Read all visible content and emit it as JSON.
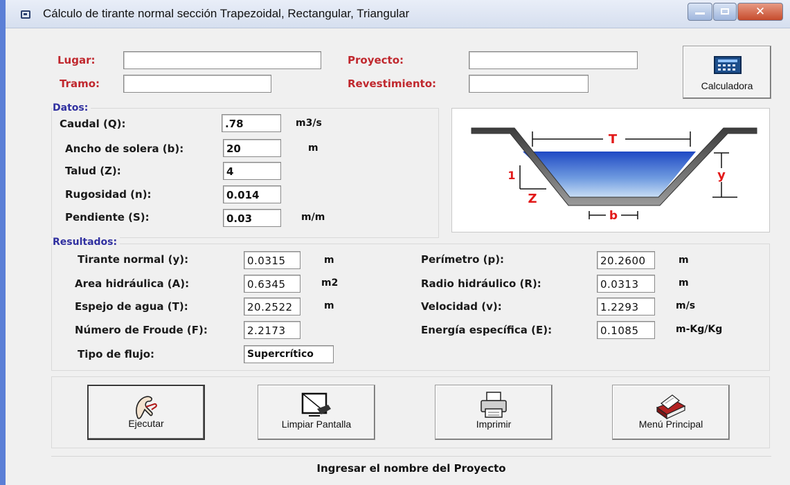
{
  "window": {
    "title": "Cálculo de tirante normal sección Trapezoidal, Rectangular, Triangular"
  },
  "header": {
    "lugar_label": "Lugar:",
    "lugar_value": "",
    "proyecto_label": "Proyecto:",
    "proyecto_value": "",
    "tramo_label": "Tramo:",
    "tramo_value": "",
    "revestimiento_label": "Revestimiento:",
    "revestimiento_value": "",
    "calc_button_label": "Calculadora"
  },
  "datos": {
    "section_label": "Datos:",
    "caudal_label": "Caudal (Q):",
    "caudal_value": ".78",
    "caudal_unit": "m3/s",
    "ancho_label": "Ancho de solera (b):",
    "ancho_value": "20",
    "ancho_unit": "m",
    "talud_label": "Talud (Z):",
    "talud_value": "4",
    "rugosidad_label": "Rugosidad (n):",
    "rugosidad_value": "0.014",
    "pendiente_label": "Pendiente (S):",
    "pendiente_value": "0.03",
    "pendiente_unit": "m/m"
  },
  "diagram": {
    "T": "T",
    "one": "1",
    "Z": "Z",
    "y": "y",
    "b": "b"
  },
  "resultados": {
    "section_label": "Resultados:",
    "tirante_label": "Tirante normal (y):",
    "tirante_value": "0.0315",
    "tirante_unit": "m",
    "area_label": "Area hidráulica (A):",
    "area_value": "0.6345",
    "area_unit": "m2",
    "espejo_label": "Espejo de agua (T):",
    "espejo_value": "20.2522",
    "espejo_unit": "m",
    "froude_label": "Número de Froude (F):",
    "froude_value": "2.2173",
    "tipo_label": "Tipo de flujo:",
    "tipo_value": "Supercrítico",
    "perimetro_label": "Perímetro (p):",
    "perimetro_value": "20.2600",
    "perimetro_unit": "m",
    "radio_label": "Radio hidráulico (R):",
    "radio_value": "0.0313",
    "radio_unit": "m",
    "velocidad_label": "Velocidad (v):",
    "velocidad_value": "1.2293",
    "velocidad_unit": "m/s",
    "energia_label": "Energía específica (E):",
    "energia_value": "0.1085",
    "energia_unit": "m-Kg/Kg"
  },
  "buttons": {
    "ejecutar": "Ejecutar",
    "limpiar": "Limpiar Pantalla",
    "imprimir": "Imprimir",
    "menu": "Menú Principal"
  },
  "status_text": "Ingresar el nombre del Proyecto",
  "colors": {
    "red_labels": "#c0282e",
    "blue_section": "#3030a0",
    "water": "#1f49c4"
  }
}
